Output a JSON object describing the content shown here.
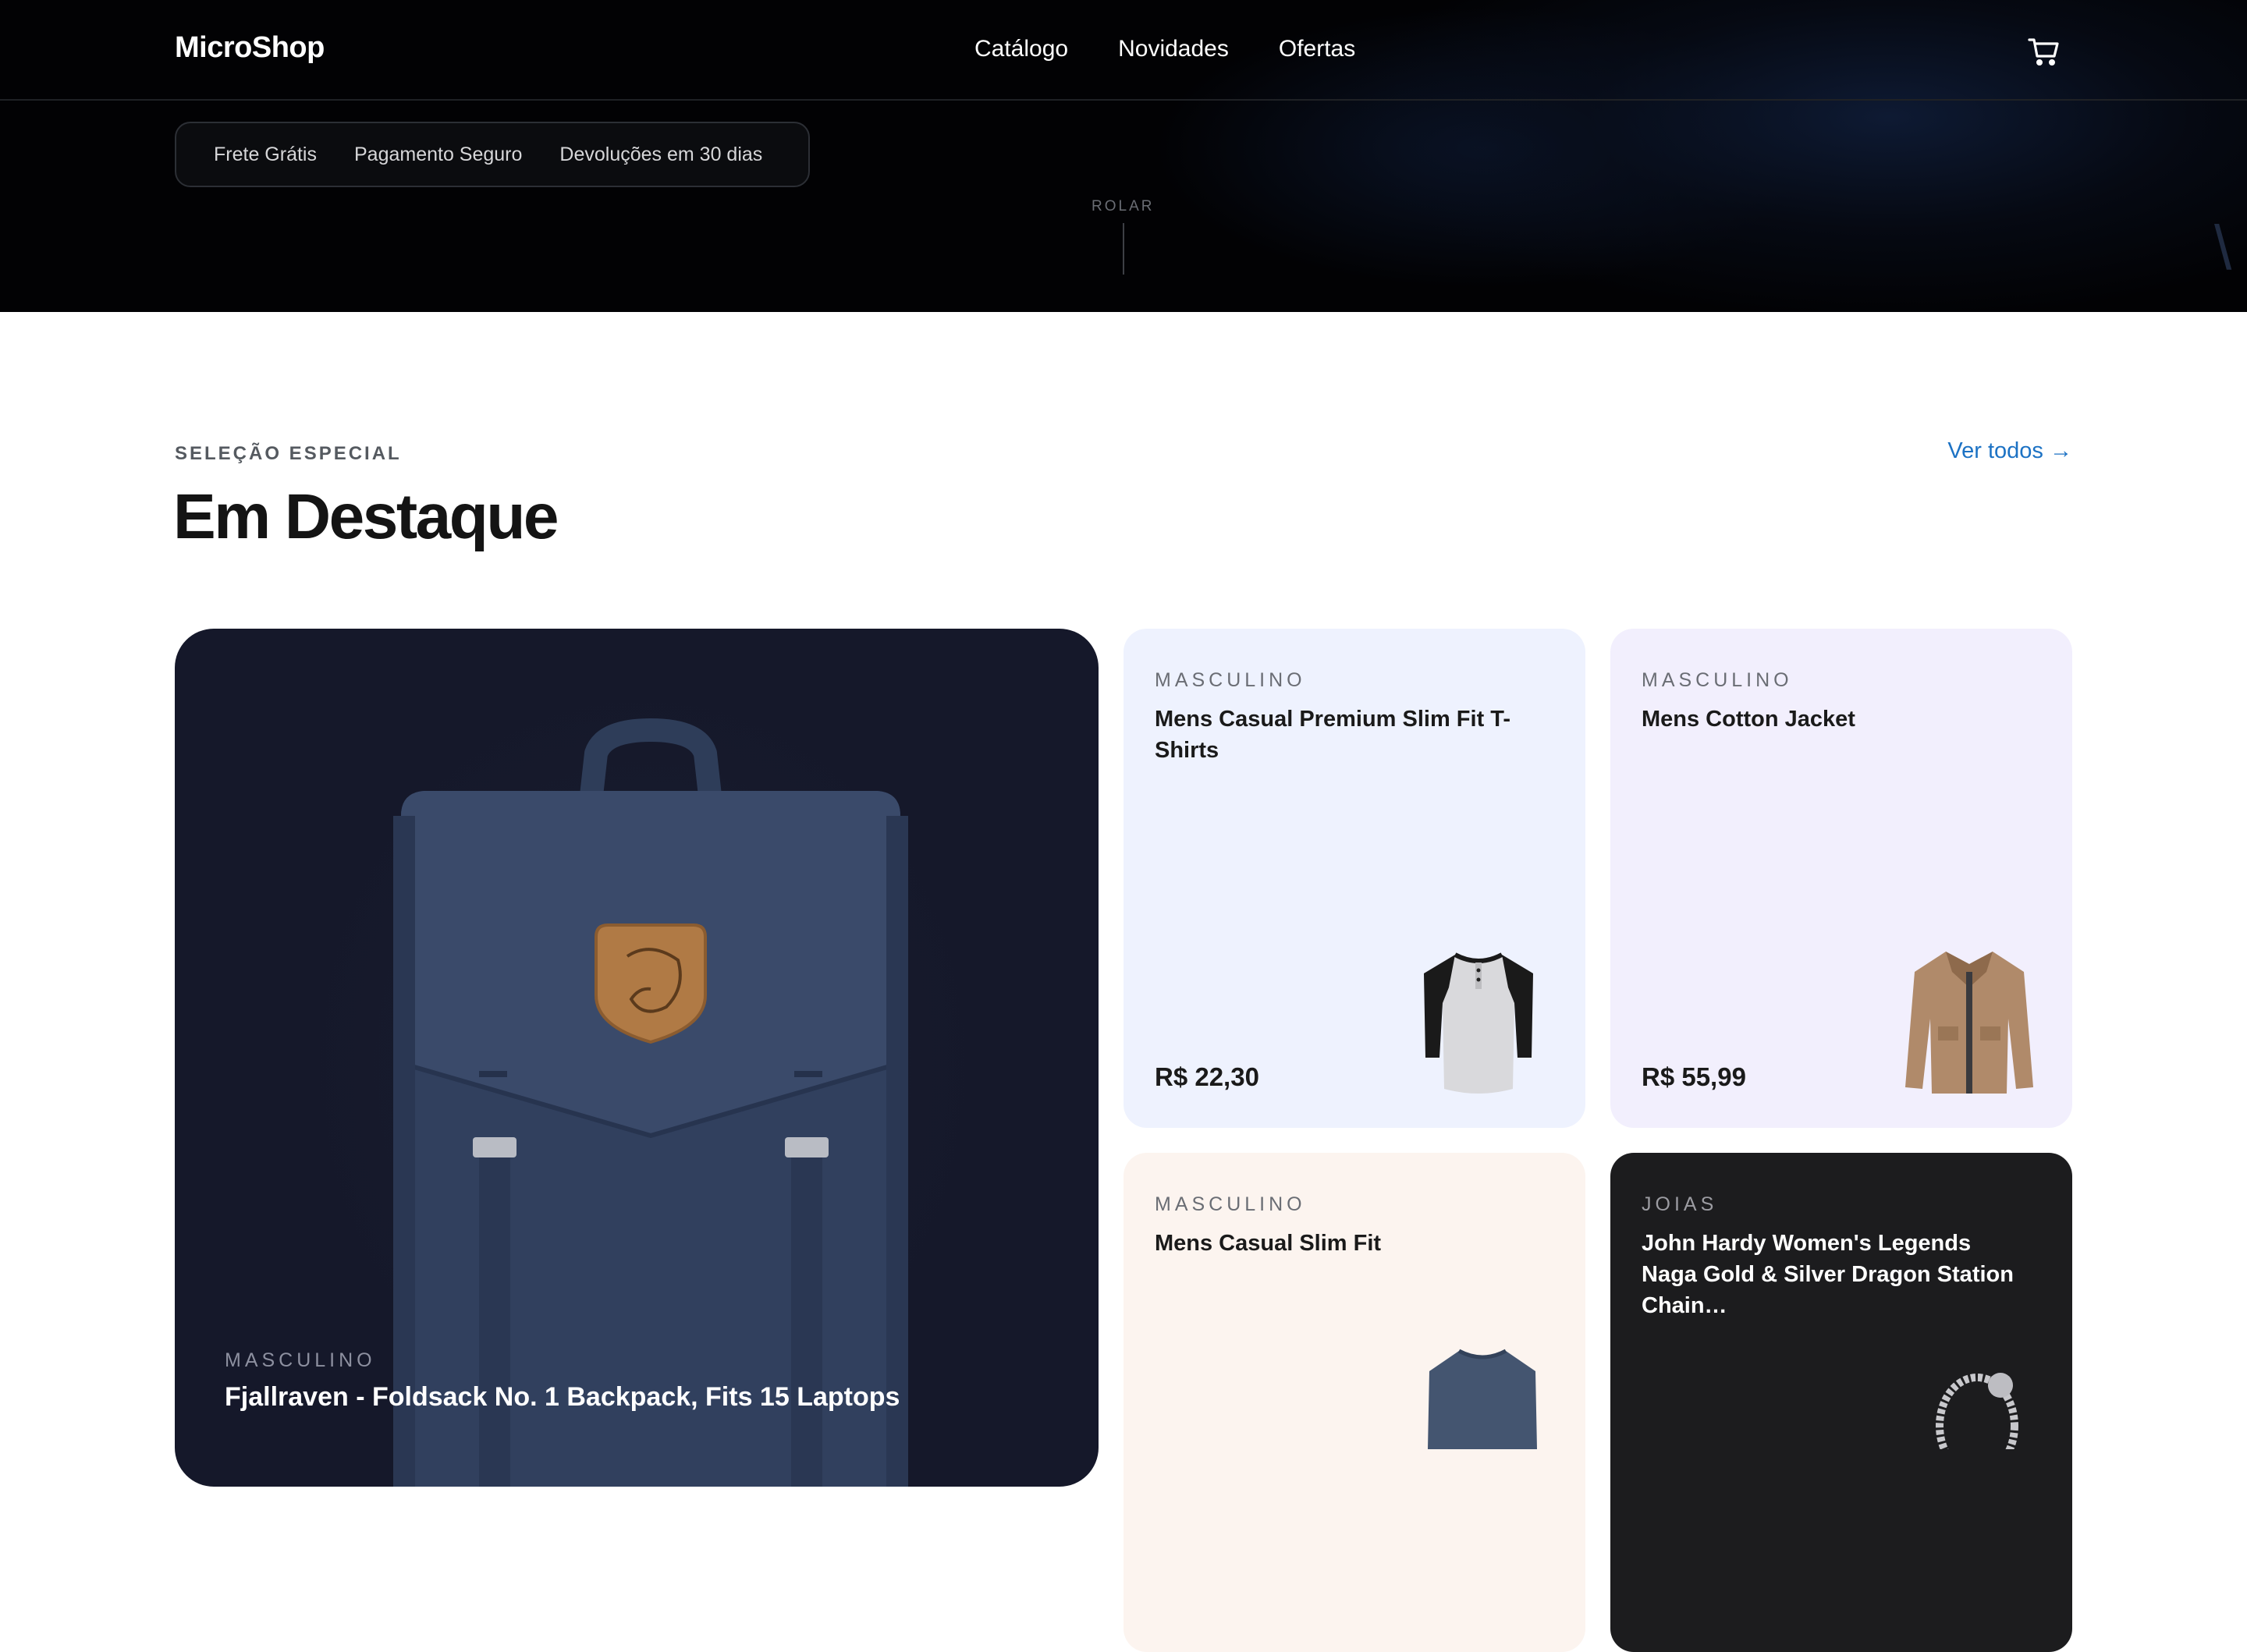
{
  "header": {
    "logo": "MicroShop",
    "nav": [
      "Catálogo",
      "Novidades",
      "Ofertas"
    ],
    "cart_icon": "cart-icon"
  },
  "hero": {
    "badges": [
      "Frete Grátis",
      "Pagamento Seguro",
      "Devoluções em 30 dias"
    ],
    "scroll_label": "ROLAR"
  },
  "featured": {
    "eyebrow": "SELEÇÃO ESPECIAL",
    "title": "Em Destaque",
    "view_all": "Ver todos →",
    "main_product": {
      "category": "MASCULINO",
      "title": "Fjallraven - Foldsack No. 1 Backpack, Fits 15 Laptops"
    },
    "products": [
      {
        "category": "MASCULINO",
        "title": "Mens Casual Premium Slim Fit T-Shirts",
        "price": "R$ 22,30"
      },
      {
        "category": "MASCULINO",
        "title": "Mens Cotton Jacket",
        "price": "R$ 55,99"
      },
      {
        "category": "MASCULINO",
        "title": "Mens Casual Slim Fit",
        "price": ""
      },
      {
        "category": "JOIAS",
        "title": "John Hardy Women's Legends Naga Gold & Silver Dragon Station Chain…",
        "price": ""
      }
    ]
  },
  "colors": {
    "accent_link": "#1c72c4",
    "hero_bg": "#020204",
    "card_main_bg": "#161a2c",
    "card_blue": "#eef2fe",
    "card_lavender": "#f2effd",
    "card_peach": "#fcf4ef",
    "card_dark": "#1c1c1e"
  }
}
